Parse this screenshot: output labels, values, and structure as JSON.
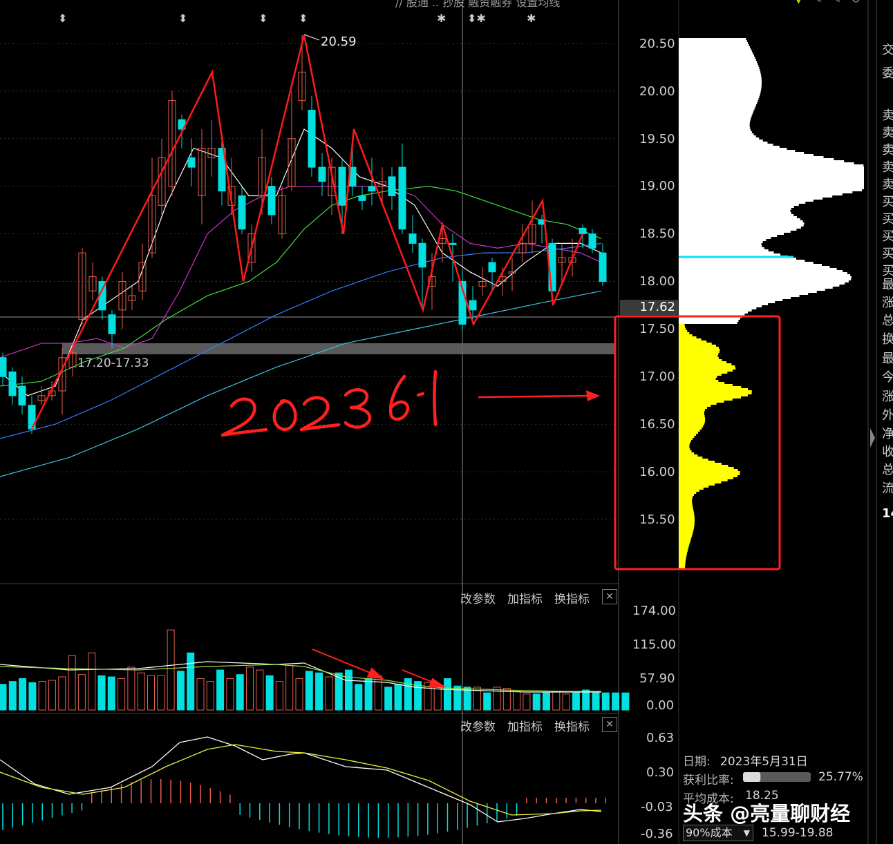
{
  "top_menu": {
    "text": "// 股通   .. 抄股   融资融券   设置均线"
  },
  "markers": [
    "⬍",
    "⬍",
    "⬍",
    "⬍",
    "✱",
    "⬍✱",
    "✱"
  ],
  "main_chart": {
    "high_label": "20.59",
    "support_zone_label": "17.20-17.33",
    "price_axis": [
      "20.50",
      "20.00",
      "19.50",
      "19.00",
      "18.50",
      "18.00",
      "17.50",
      "17.00",
      "16.50",
      "16.00",
      "15.50"
    ],
    "current_price": "17.62",
    "annotation_text": "2023 6.1"
  },
  "volume_panel": {
    "toolbar": {
      "change_params": "改参数",
      "add_indicator": "加指标",
      "switch_indicator": "换指标",
      "close": "✕"
    },
    "axis": [
      "174.00",
      "115.00",
      "57.90",
      "0.00"
    ]
  },
  "macd_panel": {
    "toolbar": {
      "change_params": "改参数",
      "add_indicator": "加指标",
      "switch_indicator": "换指标",
      "close": "✕"
    },
    "axis": [
      "0.63",
      "0.30",
      "-0.03",
      "-0.36"
    ]
  },
  "side_panel": {
    "chars": [
      "交",
      "委",
      "卖",
      "卖",
      "卖",
      "卖",
      "卖",
      "买",
      "买",
      "买",
      "买",
      "买",
      "最",
      "涨",
      "总",
      "换",
      "最",
      "今",
      "涨",
      "外",
      "净",
      "收",
      "总",
      "流"
    ],
    "bottom_number": "14"
  },
  "chip_info": {
    "date_label": "日期:",
    "date_value": "2023年5月31日",
    "profit_label": "获利比率:",
    "profit_value": "25.77%",
    "profit_fraction": 0.2577,
    "avg_cost_label": "平均成本:",
    "avg_cost_value": "18.25",
    "cost_select": "90%成本",
    "cost_range": "15.99-19.88"
  },
  "watermark": "头条 @亮量聊财经",
  "colors": {
    "up": "#e8604c",
    "down": "#00e0e0",
    "chip_profit": "#ffff00",
    "chip_loss": "#ffffff",
    "annotation": "#ff2020"
  }
}
